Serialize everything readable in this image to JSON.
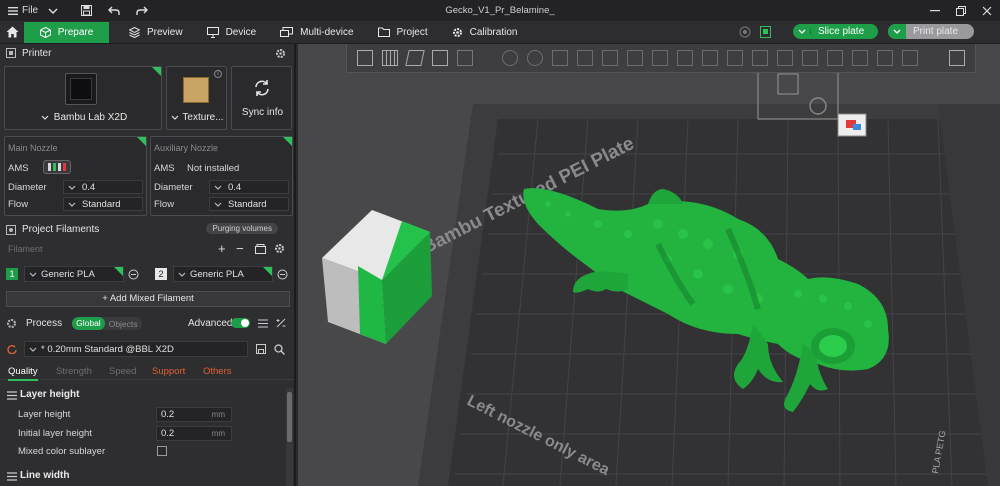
{
  "titlebar": {
    "menu_label": "File",
    "doc_title": "Gecko_V1_Pr_Belamine_"
  },
  "nav": {
    "tabs": [
      {
        "label": "Prepare"
      },
      {
        "label": "Preview"
      },
      {
        "label": "Device"
      },
      {
        "label": "Multi-device"
      },
      {
        "label": "Project"
      },
      {
        "label": "Calibration"
      }
    ],
    "slice_label": "Slice plate",
    "print_label": "Print plate",
    "accent_color": "#1f9e4a"
  },
  "printer": {
    "title": "Printer",
    "model": "Bambu Lab X2D",
    "plate": "Texture...",
    "sync": "Sync info"
  },
  "main_nozzle": {
    "title": "Main Nozzle",
    "ams_label": "AMS",
    "diameter_label": "Diameter",
    "diameter": "0.4",
    "flow_label": "Flow",
    "flow": "Standard"
  },
  "aux_nozzle": {
    "title": "Auxiliary Nozzle",
    "ams_label": "AMS",
    "ams_value": "Not installed",
    "diameter_label": "Diameter",
    "diameter": "0.4",
    "flow_label": "Flow",
    "flow": "Standard"
  },
  "filaments": {
    "title": "Project Filaments",
    "purge": "Purging volumes",
    "sub": "Filament",
    "items": [
      {
        "num": "1",
        "name": "Generic PLA"
      },
      {
        "num": "2",
        "name": "Generic PLA"
      }
    ],
    "add_mixed": "+ Add Mixed Filament"
  },
  "process": {
    "title": "Process",
    "global": "Global",
    "objects": "Objects",
    "advanced": "Advanced",
    "preset": "* 0.20mm Standard @BBL X2D",
    "tabs": [
      "Quality",
      "Strength",
      "Speed",
      "Support",
      "Others"
    ],
    "layer_section": "Layer height",
    "rows": [
      {
        "label": "Layer height",
        "value": "0.2",
        "unit": "mm"
      },
      {
        "label": "Initial layer height",
        "value": "0.2",
        "unit": "mm"
      }
    ],
    "mixed_label": "Mixed color sublayer",
    "line_section": "Line width"
  },
  "viewport": {
    "plate_text": "Bambu Textured PEI Plate",
    "nozzle_text": "Left nozzle only area",
    "side_text": "PLA PETG"
  }
}
